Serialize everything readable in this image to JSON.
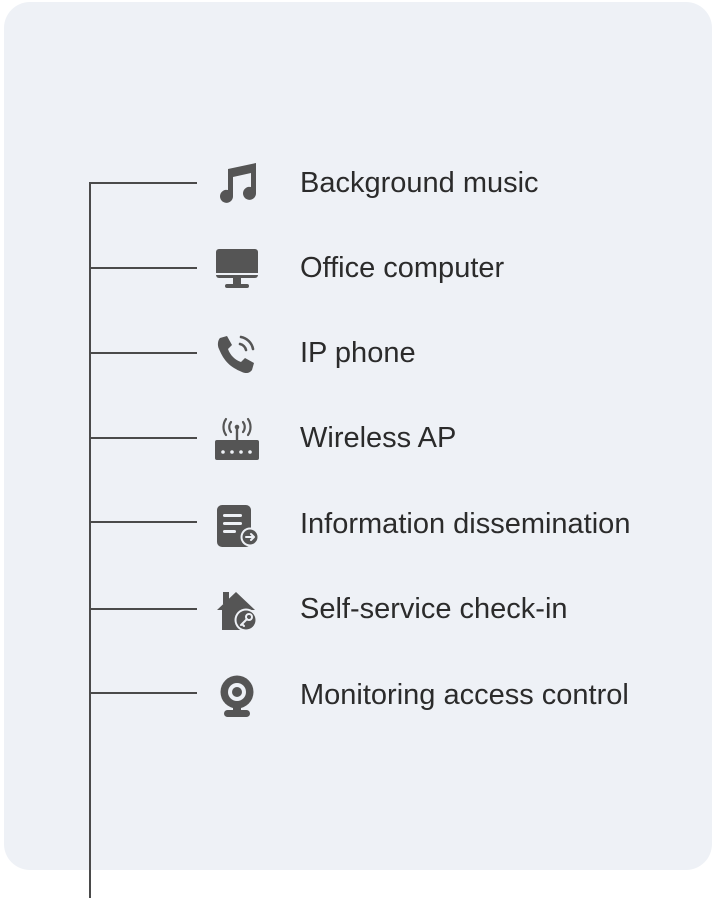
{
  "items": [
    {
      "label": "Background music",
      "icon": "music-note-icon"
    },
    {
      "label": "Office computer",
      "icon": "monitor-icon"
    },
    {
      "label": "IP phone",
      "icon": "phone-icon"
    },
    {
      "label": "Wireless AP",
      "icon": "wireless-router-icon"
    },
    {
      "label": "Information dissemination",
      "icon": "document-share-icon"
    },
    {
      "label": "Self-service check-in",
      "icon": "house-key-icon"
    },
    {
      "label": "Monitoring access control",
      "icon": "webcam-icon"
    }
  ],
  "colors": {
    "panel": "#eef1f6",
    "line": "#4a4a4a",
    "icon": "#555555",
    "text": "#2b2b2b"
  }
}
